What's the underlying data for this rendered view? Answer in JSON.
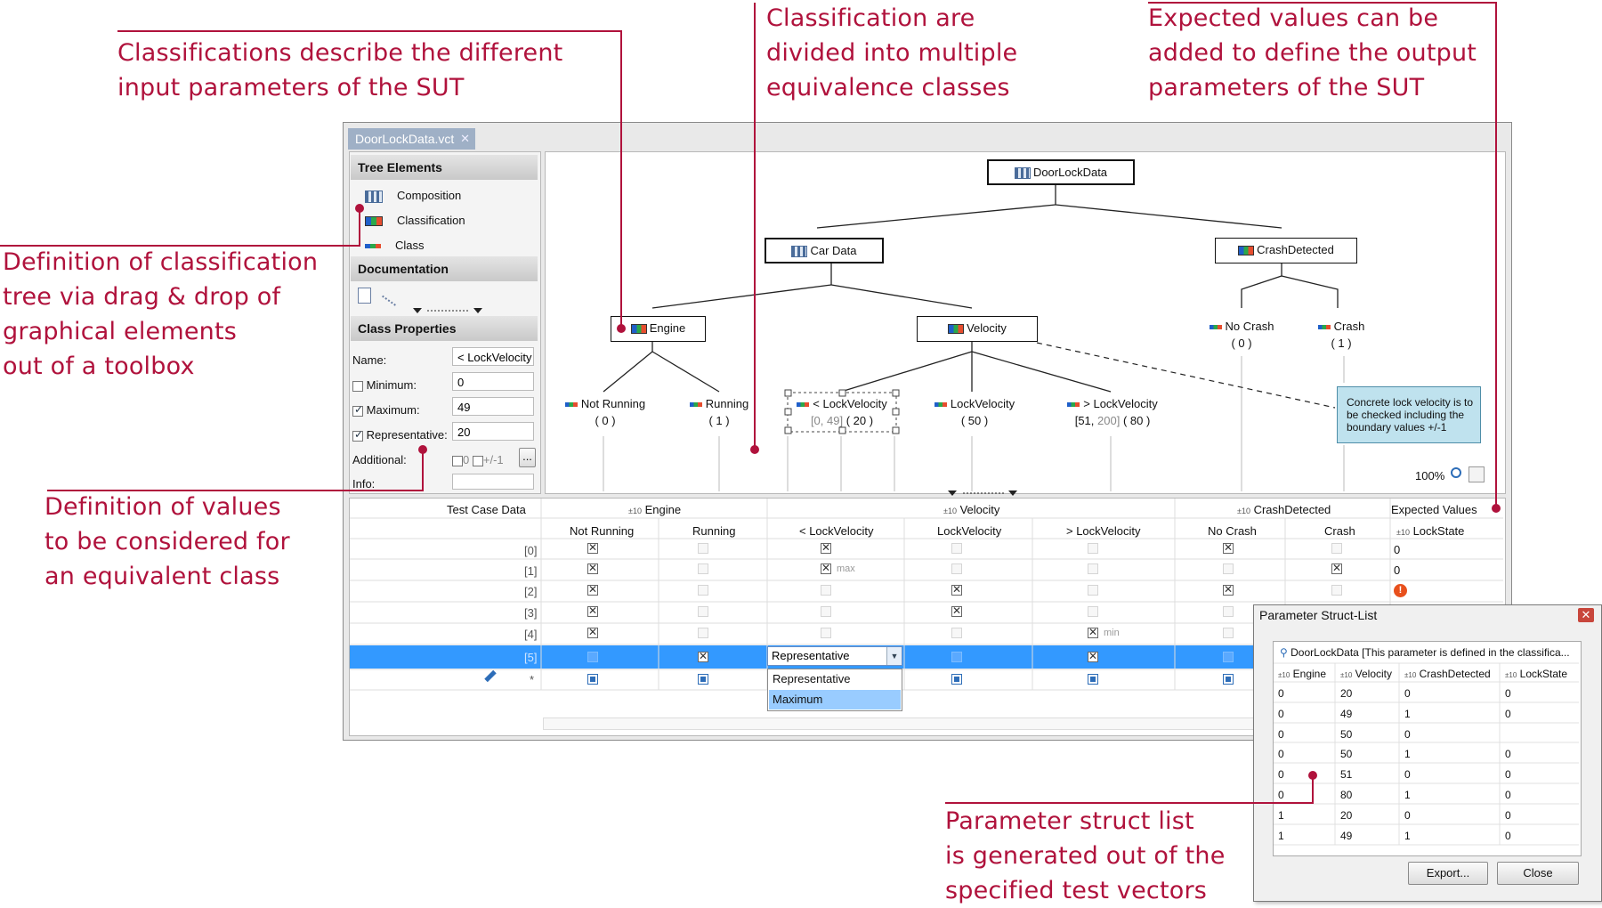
{
  "annotations": {
    "classifications": [
      "Classifications describe the different",
      "input parameters of the SUT"
    ],
    "equivalence": [
      "Classification are",
      "divided into multiple",
      "equivalence classes"
    ],
    "expected": [
      "Expected values can be",
      "added to define the output",
      "parameters of the SUT"
    ],
    "tree_definition": [
      "Definition of classification",
      "tree via drag & drop of",
      "graphical elements",
      "out of a toolbox"
    ],
    "values_definition": [
      "Definition of values",
      "to be considered for",
      "an equivalent class"
    ],
    "struct_list": [
      "Parameter struct list",
      "is generated out of the",
      "specified test vectors"
    ]
  },
  "tab": {
    "title": "DoorLockData.vct",
    "close": "✕"
  },
  "toolbox": {
    "tree_elements": "Tree Elements",
    "items": [
      "Composition",
      "Classification",
      "Class"
    ],
    "documentation": "Documentation",
    "class_properties": "Class Properties"
  },
  "properties": {
    "name_label": "Name:",
    "name_value": "< LockVelocity",
    "minimum_label": "Minimum:",
    "minimum_value": "0",
    "minimum_checked": false,
    "maximum_label": "Maximum:",
    "maximum_value": "49",
    "maximum_checked": true,
    "representative_label": "Representative:",
    "representative_value": "20",
    "representative_checked": true,
    "additional_label": "Additional:",
    "additional_zero": "0",
    "additional_pm": "+/-1",
    "additional_more": "...",
    "info_label": "Info:"
  },
  "tree": {
    "root": "DoorLockData",
    "car_data": "Car Data",
    "crash_detected": "CrashDetected",
    "engine": "Engine",
    "velocity": "Velocity",
    "classes": {
      "not_running": {
        "label": "Not Running",
        "value": "( 0 )"
      },
      "running": {
        "label": "Running",
        "value": "( 1 )"
      },
      "lt_lock": {
        "label": "< LockVelocity",
        "range": "[0, 49]",
        "value": "( 20 )"
      },
      "lock": {
        "label": "LockVelocity",
        "value": "( 50 )"
      },
      "gt_lock": {
        "label": "> LockVelocity",
        "range_lo": "[51, ",
        "range_hi": "200]",
        "value": "( 80 )"
      },
      "no_crash": {
        "label": "No Crash",
        "value": "( 0 )"
      },
      "crash": {
        "label": "Crash",
        "value": "( 1 )"
      }
    },
    "note": "Concrete lock velocity is to be checked including the boundary values +/-1",
    "zoom": "100%"
  },
  "grid": {
    "test_case_data": "Test Case Data",
    "group_engine": "Engine",
    "group_velocity": "Velocity",
    "group_crash": "CrashDetected",
    "group_expected": "Expected Values",
    "type_prefix": "±10",
    "columns": [
      "Not Running",
      "Running",
      "< LockVelocity",
      "LockVelocity",
      "> LockVelocity",
      "No Crash",
      "Crash",
      "LockState"
    ],
    "row_labels": [
      "[0]",
      "[1]",
      "[2]",
      "[3]",
      "[4]",
      "[5]",
      "*"
    ],
    "row1_max": "max",
    "row4_min": "min",
    "lockstate": [
      "0",
      "0"
    ],
    "dropdown_value": "Representative",
    "dropdown_options": [
      "Representative",
      "Maximum"
    ]
  },
  "dialog": {
    "title": "Parameter Struct-List",
    "close": "✕",
    "header": "DoorLockData [This parameter is defined in the classifica...",
    "columns": [
      "Engine",
      "Velocity",
      "CrashDetected",
      "LockState"
    ],
    "rows": [
      [
        "0",
        "20",
        "0",
        "0"
      ],
      [
        "0",
        "49",
        "1",
        "0"
      ],
      [
        "0",
        "50",
        "0",
        ""
      ],
      [
        "0",
        "50",
        "1",
        "0"
      ],
      [
        "0",
        "51",
        "0",
        "0"
      ],
      [
        "0",
        "80",
        "1",
        "0"
      ],
      [
        "1",
        "20",
        "0",
        "0"
      ],
      [
        "1",
        "49",
        "1",
        "0"
      ]
    ],
    "export": "Export...",
    "close_button": "Close"
  },
  "colors": {
    "annotation": "#b0123c",
    "selection": "#3399ff",
    "note": "#bfe2ee",
    "tab": "#9fb0c6"
  }
}
